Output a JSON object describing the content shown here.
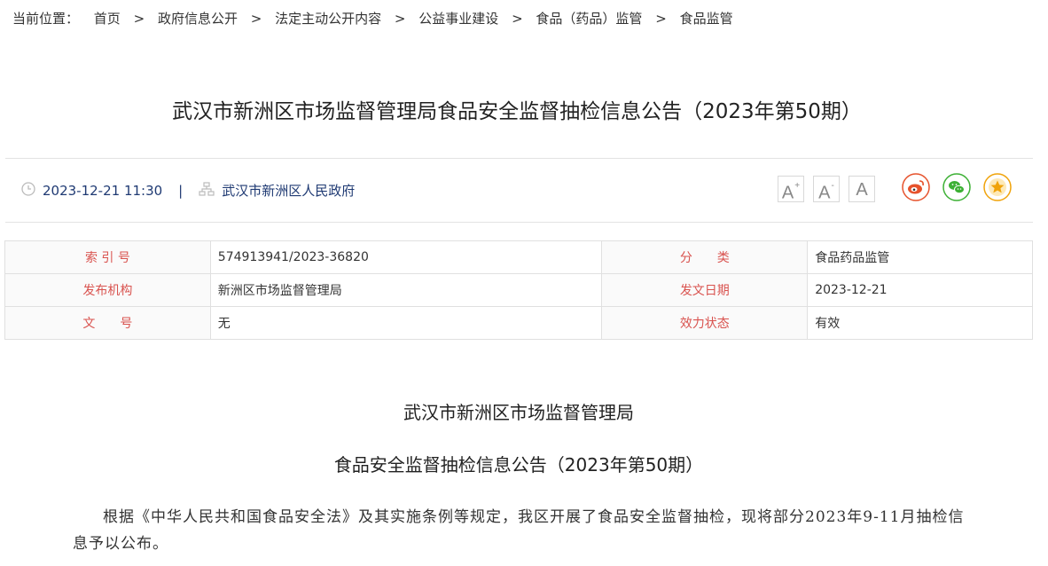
{
  "breadcrumb": {
    "prefix": "当前位置：",
    "items": [
      "首页",
      "政府信息公开",
      "法定主动公开内容",
      "公益事业建设",
      "食品（药品）监管",
      "食品监管"
    ],
    "separator": ">"
  },
  "article": {
    "title": "武汉市新洲区市场监督管理局食品安全监督抽检信息公告（2023年第50期）",
    "datetime": "2023-12-21 11:30",
    "separator": "|",
    "source": "武汉市新洲区人民政府",
    "heading_org": "武汉市新洲区市场监督管理局",
    "heading_title": "食品安全监督抽检信息公告（2023年第50期）",
    "paragraph": "根据《中华人民共和国食品安全法》及其实施条例等规定，我区开展了食品安全监督抽检，现将部分2023年9-11月抽检信息予以公布。"
  },
  "font_buttons": {
    "larger": "A",
    "larger_sup": "+",
    "smaller": "A",
    "smaller_sup": "-",
    "default": "A"
  },
  "share_icons": [
    "weibo-icon",
    "wechat-icon",
    "favorite-star-icon"
  ],
  "info_table": {
    "rows": [
      {
        "label1": "索 引 号",
        "value1": "574913941/2023-36820",
        "label2": "分　　类",
        "value2": "食品药品监管"
      },
      {
        "label1": "发布机构",
        "value1": "新洲区市场监督管理局",
        "label2": "发文日期",
        "value2": "2023-12-21"
      },
      {
        "label1": "文　　号",
        "value1": "无",
        "label2": "效力状态",
        "value2": "有效"
      }
    ]
  },
  "colors": {
    "label_red": "#d9534f",
    "meta_blue": "#1f3a73",
    "weibo": "#e6522c",
    "wechat": "#3cb034",
    "star": "#f0a30a"
  }
}
